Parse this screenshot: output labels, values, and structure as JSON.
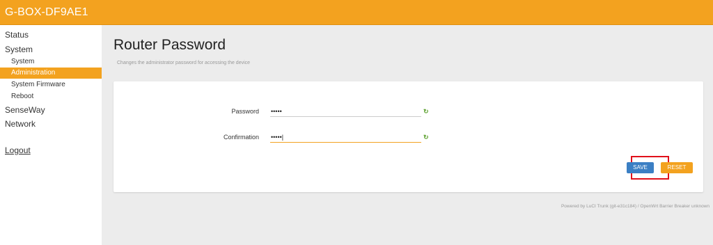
{
  "header": {
    "hostname": "G-BOX-DF9AE1"
  },
  "sidebar": {
    "status": "Status",
    "system": "System",
    "system_sub": [
      "System",
      "Administration",
      "System Firmware",
      "Reboot"
    ],
    "senseway": "SenseWay",
    "network": "Network",
    "logout": "Logout"
  },
  "page": {
    "title": "Router Password",
    "description": "Changes the administrator password for accessing the device"
  },
  "form": {
    "password_label": "Password",
    "password_value": "•••••",
    "confirmation_label": "Confirmation",
    "confirmation_value": "•••••|",
    "reveal_icon": "refresh-toggle-icon"
  },
  "actions": {
    "save_label": "SAVE",
    "reset_label": "RESET"
  },
  "footer": {
    "text": "Powered by LuCI Trunk (git-e31c184) / OpenWrt Barrier Breaker unknown"
  },
  "colors": {
    "accent": "#f3a21f",
    "save_button": "#3b7fc4",
    "highlight_box": "#e0101a"
  }
}
